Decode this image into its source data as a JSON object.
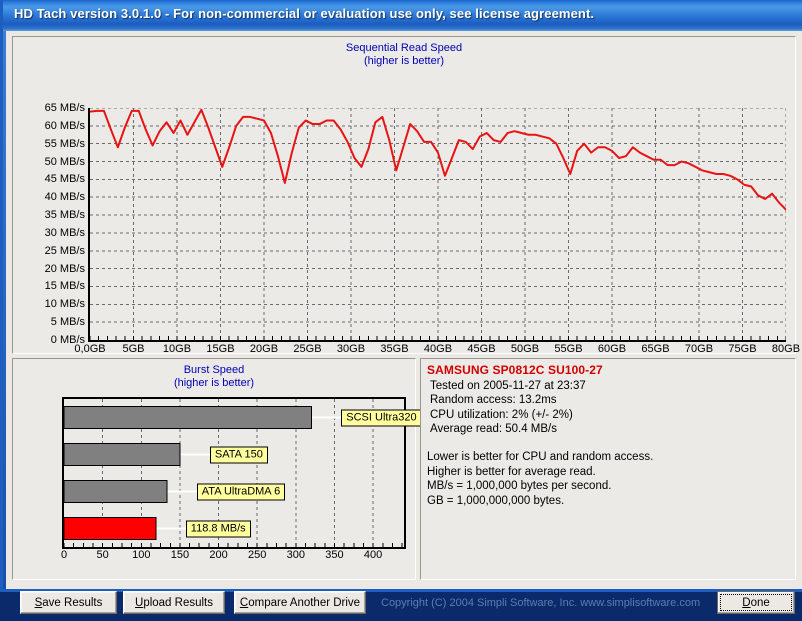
{
  "window": {
    "title": "HD Tach version 3.0.1.0  - For non-commercial or evaluation use only, see license agreement."
  },
  "chart_data": [
    {
      "type": "line",
      "title": "Sequential Read Speed",
      "subtitle": "(higher is better)",
      "xlabel": "",
      "ylabel": "",
      "xlim": [
        0,
        80
      ],
      "ylim": [
        0,
        65
      ],
      "grid": true,
      "legend": "none",
      "line_color": "#e81414",
      "ytick_labels": [
        "65 MB/s",
        "60 MB/s",
        "55 MB/s",
        "50 MB/s",
        "45 MB/s",
        "40 MB/s",
        "35 MB/s",
        "30 MB/s",
        "25 MB/s",
        "20 MB/s",
        "15 MB/s",
        "10 MB/s",
        "5 MB/s",
        "0 MB/s"
      ],
      "ytick_values": [
        65,
        60,
        55,
        50,
        45,
        40,
        35,
        30,
        25,
        20,
        15,
        10,
        5,
        0
      ],
      "xtick_labels": [
        "0,0GB",
        "5GB",
        "10GB",
        "15GB",
        "20GB",
        "25GB",
        "30GB",
        "35GB",
        "40GB",
        "45GB",
        "50GB",
        "55GB",
        "60GB",
        "65GB",
        "70GB",
        "75GB",
        "80GB"
      ],
      "xtick_values": [
        0,
        5,
        10,
        15,
        20,
        25,
        30,
        35,
        40,
        45,
        50,
        55,
        60,
        65,
        70,
        75,
        80
      ],
      "x": [
        0.0,
        0.8,
        1.6,
        2.4,
        3.2,
        4.0,
        4.8,
        5.6,
        6.4,
        7.2,
        8.0,
        8.8,
        9.6,
        10.4,
        11.2,
        12.0,
        12.8,
        13.6,
        14.4,
        15.2,
        16.0,
        16.8,
        17.6,
        18.4,
        19.2,
        20.0,
        20.8,
        21.6,
        22.4,
        23.2,
        24.0,
        24.8,
        25.6,
        26.4,
        27.2,
        28.0,
        28.8,
        29.6,
        30.4,
        31.2,
        32.0,
        32.8,
        33.6,
        34.4,
        35.2,
        36.0,
        36.8,
        37.6,
        38.4,
        39.2,
        40.0,
        40.8,
        41.6,
        42.4,
        43.2,
        44.0,
        44.8,
        45.6,
        46.4,
        47.2,
        48.0,
        48.8,
        49.6,
        50.4,
        51.2,
        52.0,
        52.8,
        53.6,
        54.4,
        55.2,
        56.0,
        56.8,
        57.6,
        58.4,
        59.2,
        60.0,
        60.8,
        61.6,
        62.4,
        63.2,
        64.0,
        64.8,
        65.6,
        66.4,
        67.2,
        68.0,
        68.8,
        69.6,
        70.4,
        71.2,
        72.0,
        72.8,
        73.6,
        74.4,
        75.2,
        76.0,
        76.8,
        77.6,
        78.4,
        79.2,
        80.0
      ],
      "y": [
        64.0,
        64.2,
        64.2,
        59.0,
        54.0,
        59.5,
        64.2,
        64.2,
        59.0,
        54.5,
        58.5,
        61.0,
        58.0,
        61.5,
        57.5,
        61.0,
        64.5,
        59.5,
        54.0,
        48.5,
        54.0,
        60.0,
        62.5,
        62.5,
        62.0,
        61.5,
        58.0,
        51.5,
        44.0,
        52.5,
        59.5,
        61.5,
        60.5,
        60.5,
        61.5,
        61.5,
        59.0,
        55.5,
        51.0,
        48.5,
        53.5,
        61.0,
        62.5,
        56.0,
        47.5,
        54.0,
        60.5,
        58.5,
        55.5,
        55.5,
        52.5,
        46.0,
        51.0,
        56.0,
        55.5,
        53.5,
        57.0,
        58.0,
        56.0,
        55.5,
        58.0,
        58.5,
        58.0,
        57.5,
        57.5,
        57.0,
        56.5,
        55.0,
        51.0,
        46.5,
        53.0,
        55.0,
        52.5,
        54.0,
        54.0,
        53.0,
        51.0,
        51.5,
        54.0,
        52.5,
        51.5,
        50.5,
        50.5,
        49.0,
        49.0,
        50.0,
        49.5,
        48.5,
        47.5,
        47.0,
        46.5,
        46.5,
        46.0,
        45.0,
        43.5,
        43.0,
        40.5,
        39.5,
        41.0,
        38.5,
        36.5
      ]
    },
    {
      "type": "bar",
      "orientation": "horizontal",
      "title": "Burst Speed",
      "subtitle": "(higher is better)",
      "xlabel": "",
      "ylabel": "",
      "xlim": [
        0,
        440
      ],
      "grid": true,
      "xtick_labels": [
        "0",
        "50",
        "100",
        "150",
        "200",
        "250",
        "300",
        "350",
        "400"
      ],
      "xtick_values": [
        0,
        50,
        100,
        150,
        200,
        250,
        300,
        350,
        400
      ],
      "categories": [
        "SCSI Ultra320",
        "SATA 150",
        "ATA UltraDMA 6",
        "118.8 MB/s"
      ],
      "values": [
        320,
        150,
        133,
        118.8
      ],
      "bar_colors": [
        "#808080",
        "#808080",
        "#808080",
        "#ff0000"
      ],
      "callouts": [
        "SCSI Ultra320",
        "SATA 150",
        "ATA UltraDMA 6",
        "118.8 MB/s"
      ]
    }
  ],
  "info": {
    "drive": "SAMSUNG SP0812C SU100-27",
    "lines": [
      "Tested on 2005-11-27 at 23:37",
      "Random access: 13.2ms",
      "CPU utilization: 2% (+/- 2%)",
      "Average read: 50.4 MB/s"
    ],
    "notes": [
      "Lower is better for CPU and random access.",
      "Higher is better for average read.",
      "MB/s = 1,000,000 bytes per second.",
      "GB = 1,000,000,000 bytes."
    ]
  },
  "buttons": {
    "save": "Save Results",
    "save_accel": "S",
    "upload": "Upload Results",
    "upload_accel": "U",
    "compare": "Compare Another Drive",
    "compare_accel": "C",
    "done": "Done",
    "done_accel": "D"
  },
  "copyright": "Copyright (C) 2004 Simpli Software, Inc. www.simplisoftware.com"
}
